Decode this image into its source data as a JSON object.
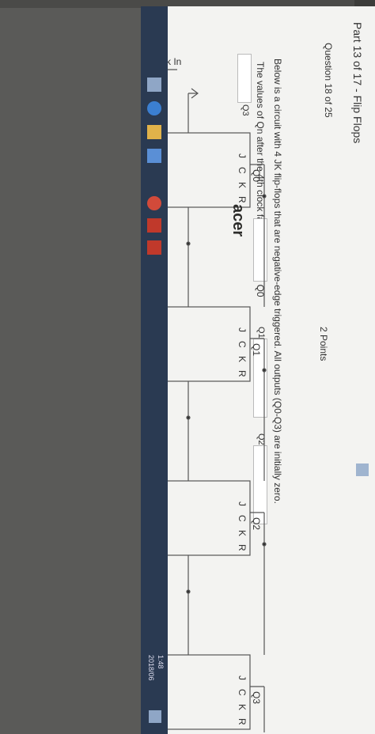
{
  "header": {
    "part_title": "Part 13 of 17 - Flip Flops",
    "question_number": "Question 18 of 25",
    "points": "2 Points"
  },
  "question": {
    "text": "Below is a circuit with 4 JK flip-flops that are negative-edge triggered. All outputs (Q0-Q3) are initially zero.",
    "prompt": "The values of Qn after the 4th clock falling edge are: Q0"
  },
  "answers": {
    "q1_label": "Q1",
    "q2_label": "Q2",
    "q3_label": "Q3"
  },
  "circuit": {
    "clock_label": "Clock In",
    "pin_j": "J",
    "pin_c": "C",
    "pin_k": "K",
    "pin_r": "R",
    "ff0_q": "Q0",
    "ff1_q": "Q1",
    "ff2_q": "Q2",
    "ff3_q": "Q3"
  },
  "taskbar": {
    "time": "1:48",
    "date": "2018/06"
  },
  "frame": {
    "brand": "acer"
  }
}
